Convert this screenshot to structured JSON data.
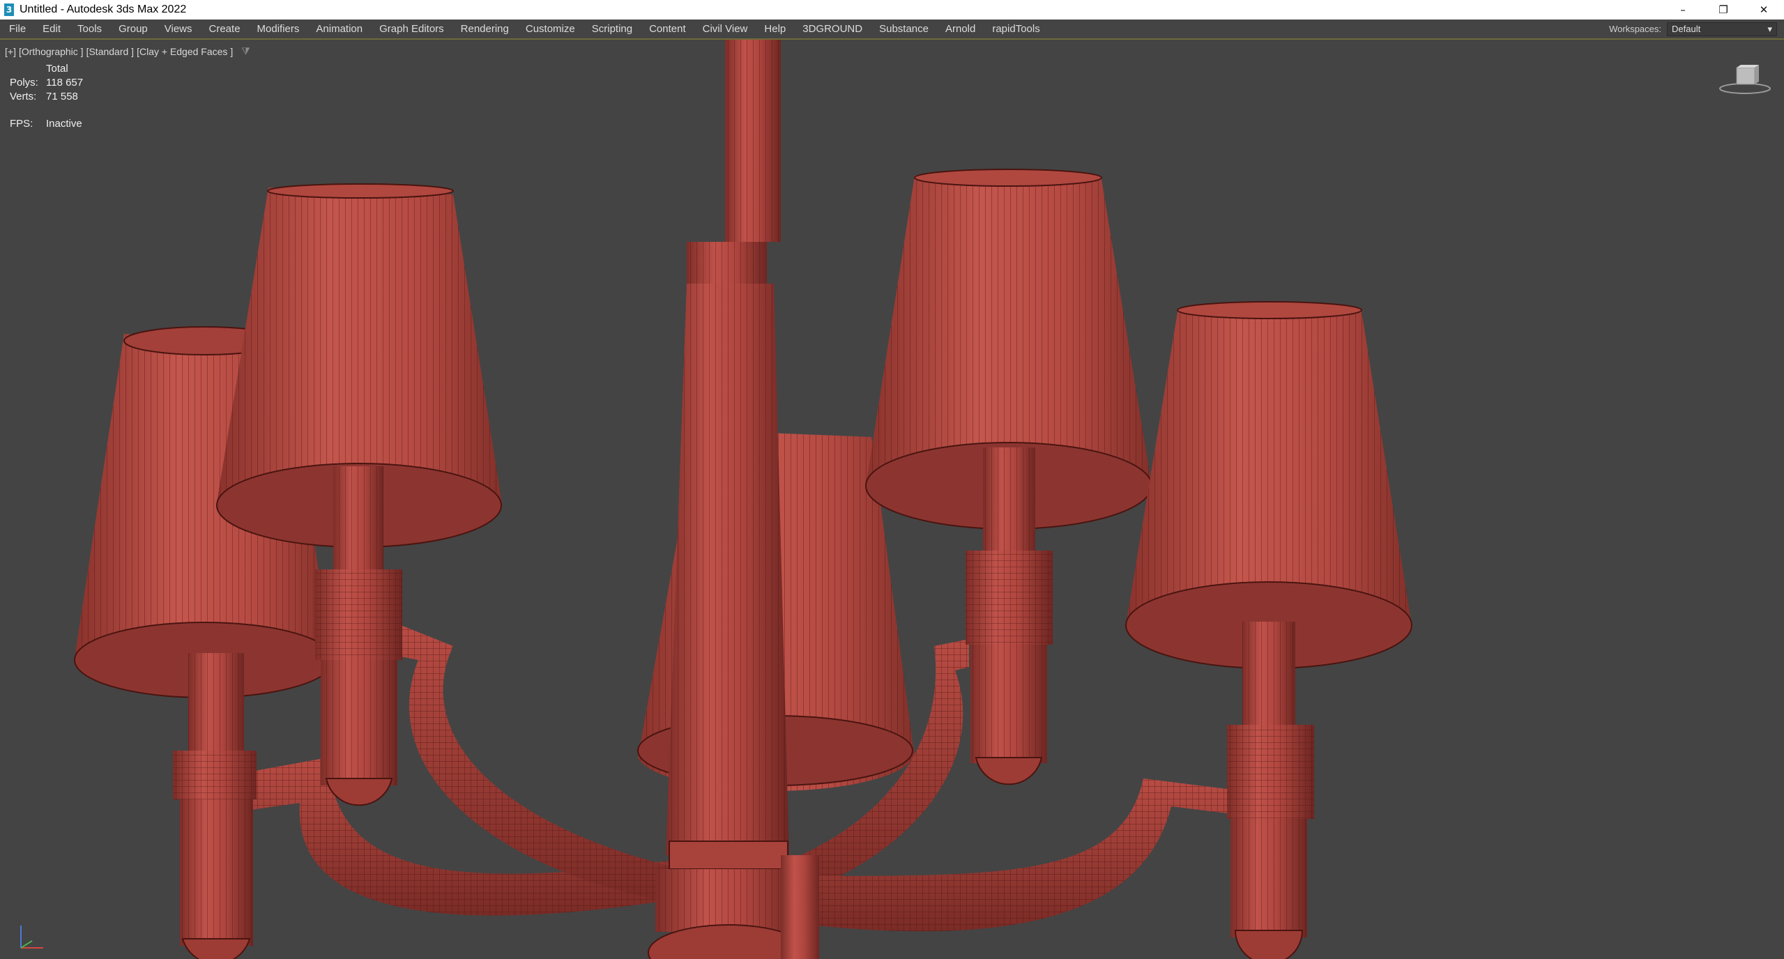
{
  "window": {
    "title": "Untitled - Autodesk 3ds Max 2022",
    "app_icon_glyph": "3",
    "controls": {
      "minimize": "–",
      "restore": "❐",
      "close": "✕"
    }
  },
  "menu": {
    "items": [
      "File",
      "Edit",
      "Tools",
      "Group",
      "Views",
      "Create",
      "Modifiers",
      "Animation",
      "Graph Editors",
      "Rendering",
      "Customize",
      "Scripting",
      "Content",
      "Civil View",
      "Help",
      "3DGROUND",
      "Substance",
      "Arnold",
      "rapidTools"
    ]
  },
  "workspaces": {
    "label": "Workspaces:",
    "value": "Default",
    "chevron": "▾"
  },
  "viewport": {
    "label_plus": "[+]",
    "label_view": "[Orthographic ]",
    "label_shading": "[Standard ]",
    "label_style": "[Clay + Edged Faces ]",
    "filter_icon": "filter-icon",
    "stats": {
      "header": "Total",
      "polys_label": "Polys:",
      "polys_value": "118 657",
      "verts_label": "Verts:",
      "verts_value": "71 558",
      "fps_label": "FPS:",
      "fps_value": "Inactive"
    }
  },
  "colors": {
    "viewport_bg": "#444444",
    "model": "#b0463f",
    "model_shadow": "#7e2d28",
    "wire": "#4a1410",
    "menubar_accent": "#6f6a3a"
  }
}
